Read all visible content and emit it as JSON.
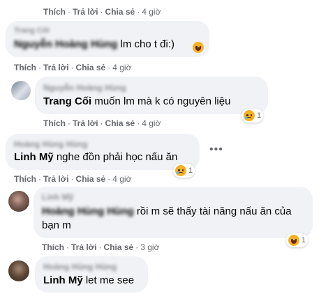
{
  "actions": {
    "like": "Thích",
    "reply": "Trả lời",
    "share": "Chia sẻ",
    "sep": "·"
  },
  "c0": {
    "time": "4 giờ"
  },
  "c1": {
    "name": "Trang Cối",
    "mention": "Nguyễn Hoàng Hùng",
    "text": "lm cho t đi:)",
    "time": "4 giờ"
  },
  "c2": {
    "name": "Nguyễn Hoàng Hùng",
    "mention": "Trang Cối",
    "text": "muốn lm mà k có nguyên liệu",
    "reaction_count": "1",
    "time": "4 giờ"
  },
  "c3": {
    "name": "Hoàng Hùng Hùng",
    "mention": "Linh Mỹ",
    "text": "nghe đồn phải học nấu ăn",
    "reaction_count": "1",
    "time": "4 giờ"
  },
  "c4": {
    "name": "Linh Mỹ",
    "mention": "Hoàng Hùng Hùng",
    "text": "rồi m sẽ thấy tài năng nấu ăn của",
    "text2": "bạn m",
    "reaction_count": "1",
    "time": "3 giờ"
  },
  "c5": {
    "name": "Hoàng Hùng Hùng",
    "mention": "Linh Mỹ",
    "text": "let me see"
  },
  "icons": {
    "more": "more-options-icon",
    "sad": "sad-emoji-icon",
    "haha": "laugh-emoji-icon",
    "grin": "grinning-emoji-icon"
  },
  "colors": {
    "bubble": "#f0f2f5",
    "meta": "#65676b",
    "emoji": "#f7b125"
  }
}
